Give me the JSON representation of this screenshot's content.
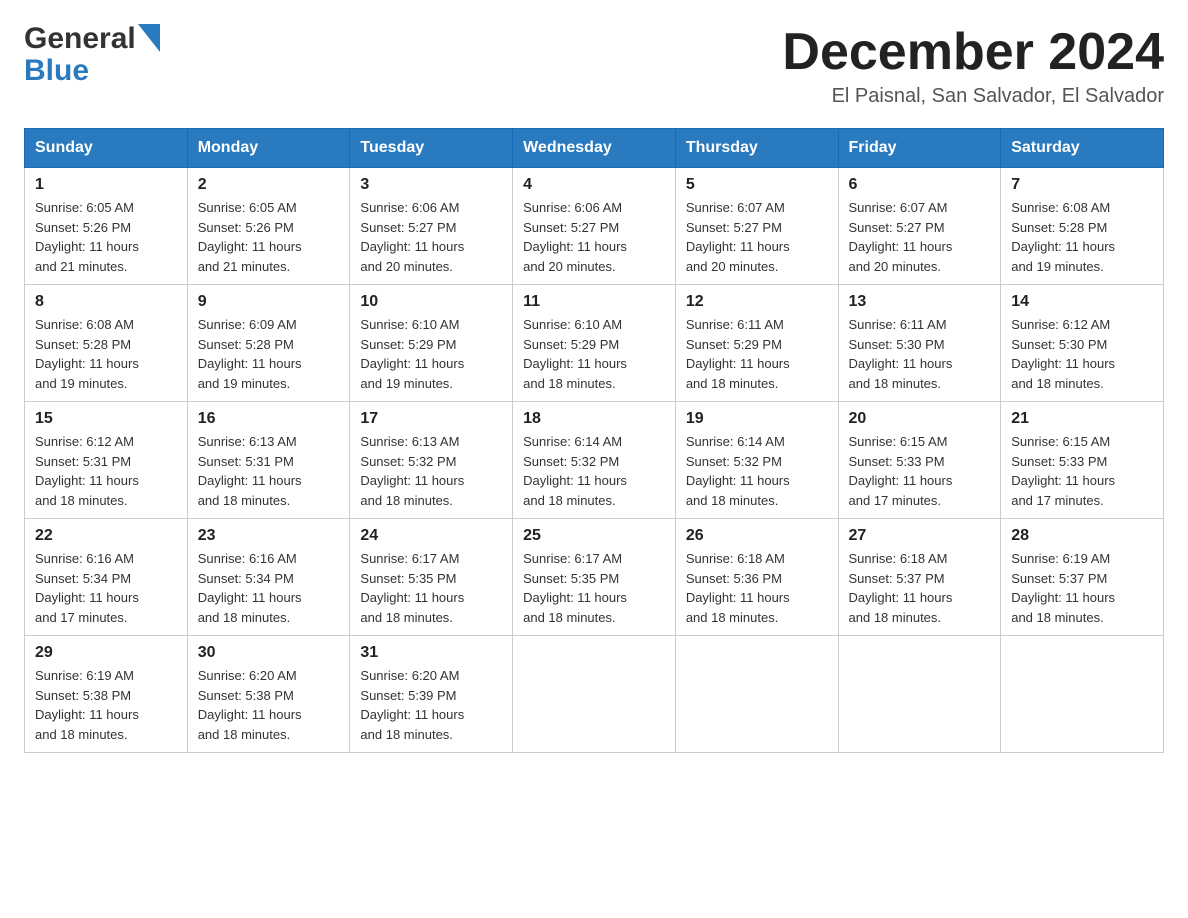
{
  "header": {
    "logo_general": "General",
    "logo_blue": "Blue",
    "month_title": "December 2024",
    "location": "El Paisnal, San Salvador, El Salvador"
  },
  "days_of_week": [
    "Sunday",
    "Monday",
    "Tuesday",
    "Wednesday",
    "Thursday",
    "Friday",
    "Saturday"
  ],
  "weeks": [
    [
      {
        "day": "1",
        "sunrise": "6:05 AM",
        "sunset": "5:26 PM",
        "daylight": "11 hours and 21 minutes."
      },
      {
        "day": "2",
        "sunrise": "6:05 AM",
        "sunset": "5:26 PM",
        "daylight": "11 hours and 21 minutes."
      },
      {
        "day": "3",
        "sunrise": "6:06 AM",
        "sunset": "5:27 PM",
        "daylight": "11 hours and 20 minutes."
      },
      {
        "day": "4",
        "sunrise": "6:06 AM",
        "sunset": "5:27 PM",
        "daylight": "11 hours and 20 minutes."
      },
      {
        "day": "5",
        "sunrise": "6:07 AM",
        "sunset": "5:27 PM",
        "daylight": "11 hours and 20 minutes."
      },
      {
        "day": "6",
        "sunrise": "6:07 AM",
        "sunset": "5:27 PM",
        "daylight": "11 hours and 20 minutes."
      },
      {
        "day": "7",
        "sunrise": "6:08 AM",
        "sunset": "5:28 PM",
        "daylight": "11 hours and 19 minutes."
      }
    ],
    [
      {
        "day": "8",
        "sunrise": "6:08 AM",
        "sunset": "5:28 PM",
        "daylight": "11 hours and 19 minutes."
      },
      {
        "day": "9",
        "sunrise": "6:09 AM",
        "sunset": "5:28 PM",
        "daylight": "11 hours and 19 minutes."
      },
      {
        "day": "10",
        "sunrise": "6:10 AM",
        "sunset": "5:29 PM",
        "daylight": "11 hours and 19 minutes."
      },
      {
        "day": "11",
        "sunrise": "6:10 AM",
        "sunset": "5:29 PM",
        "daylight": "11 hours and 18 minutes."
      },
      {
        "day": "12",
        "sunrise": "6:11 AM",
        "sunset": "5:29 PM",
        "daylight": "11 hours and 18 minutes."
      },
      {
        "day": "13",
        "sunrise": "6:11 AM",
        "sunset": "5:30 PM",
        "daylight": "11 hours and 18 minutes."
      },
      {
        "day": "14",
        "sunrise": "6:12 AM",
        "sunset": "5:30 PM",
        "daylight": "11 hours and 18 minutes."
      }
    ],
    [
      {
        "day": "15",
        "sunrise": "6:12 AM",
        "sunset": "5:31 PM",
        "daylight": "11 hours and 18 minutes."
      },
      {
        "day": "16",
        "sunrise": "6:13 AM",
        "sunset": "5:31 PM",
        "daylight": "11 hours and 18 minutes."
      },
      {
        "day": "17",
        "sunrise": "6:13 AM",
        "sunset": "5:32 PM",
        "daylight": "11 hours and 18 minutes."
      },
      {
        "day": "18",
        "sunrise": "6:14 AM",
        "sunset": "5:32 PM",
        "daylight": "11 hours and 18 minutes."
      },
      {
        "day": "19",
        "sunrise": "6:14 AM",
        "sunset": "5:32 PM",
        "daylight": "11 hours and 18 minutes."
      },
      {
        "day": "20",
        "sunrise": "6:15 AM",
        "sunset": "5:33 PM",
        "daylight": "11 hours and 17 minutes."
      },
      {
        "day": "21",
        "sunrise": "6:15 AM",
        "sunset": "5:33 PM",
        "daylight": "11 hours and 17 minutes."
      }
    ],
    [
      {
        "day": "22",
        "sunrise": "6:16 AM",
        "sunset": "5:34 PM",
        "daylight": "11 hours and 17 minutes."
      },
      {
        "day": "23",
        "sunrise": "6:16 AM",
        "sunset": "5:34 PM",
        "daylight": "11 hours and 18 minutes."
      },
      {
        "day": "24",
        "sunrise": "6:17 AM",
        "sunset": "5:35 PM",
        "daylight": "11 hours and 18 minutes."
      },
      {
        "day": "25",
        "sunrise": "6:17 AM",
        "sunset": "5:35 PM",
        "daylight": "11 hours and 18 minutes."
      },
      {
        "day": "26",
        "sunrise": "6:18 AM",
        "sunset": "5:36 PM",
        "daylight": "11 hours and 18 minutes."
      },
      {
        "day": "27",
        "sunrise": "6:18 AM",
        "sunset": "5:37 PM",
        "daylight": "11 hours and 18 minutes."
      },
      {
        "day": "28",
        "sunrise": "6:19 AM",
        "sunset": "5:37 PM",
        "daylight": "11 hours and 18 minutes."
      }
    ],
    [
      {
        "day": "29",
        "sunrise": "6:19 AM",
        "sunset": "5:38 PM",
        "daylight": "11 hours and 18 minutes."
      },
      {
        "day": "30",
        "sunrise": "6:20 AM",
        "sunset": "5:38 PM",
        "daylight": "11 hours and 18 minutes."
      },
      {
        "day": "31",
        "sunrise": "6:20 AM",
        "sunset": "5:39 PM",
        "daylight": "11 hours and 18 minutes."
      },
      null,
      null,
      null,
      null
    ]
  ],
  "labels": {
    "sunrise": "Sunrise:",
    "sunset": "Sunset:",
    "daylight": "Daylight:"
  }
}
